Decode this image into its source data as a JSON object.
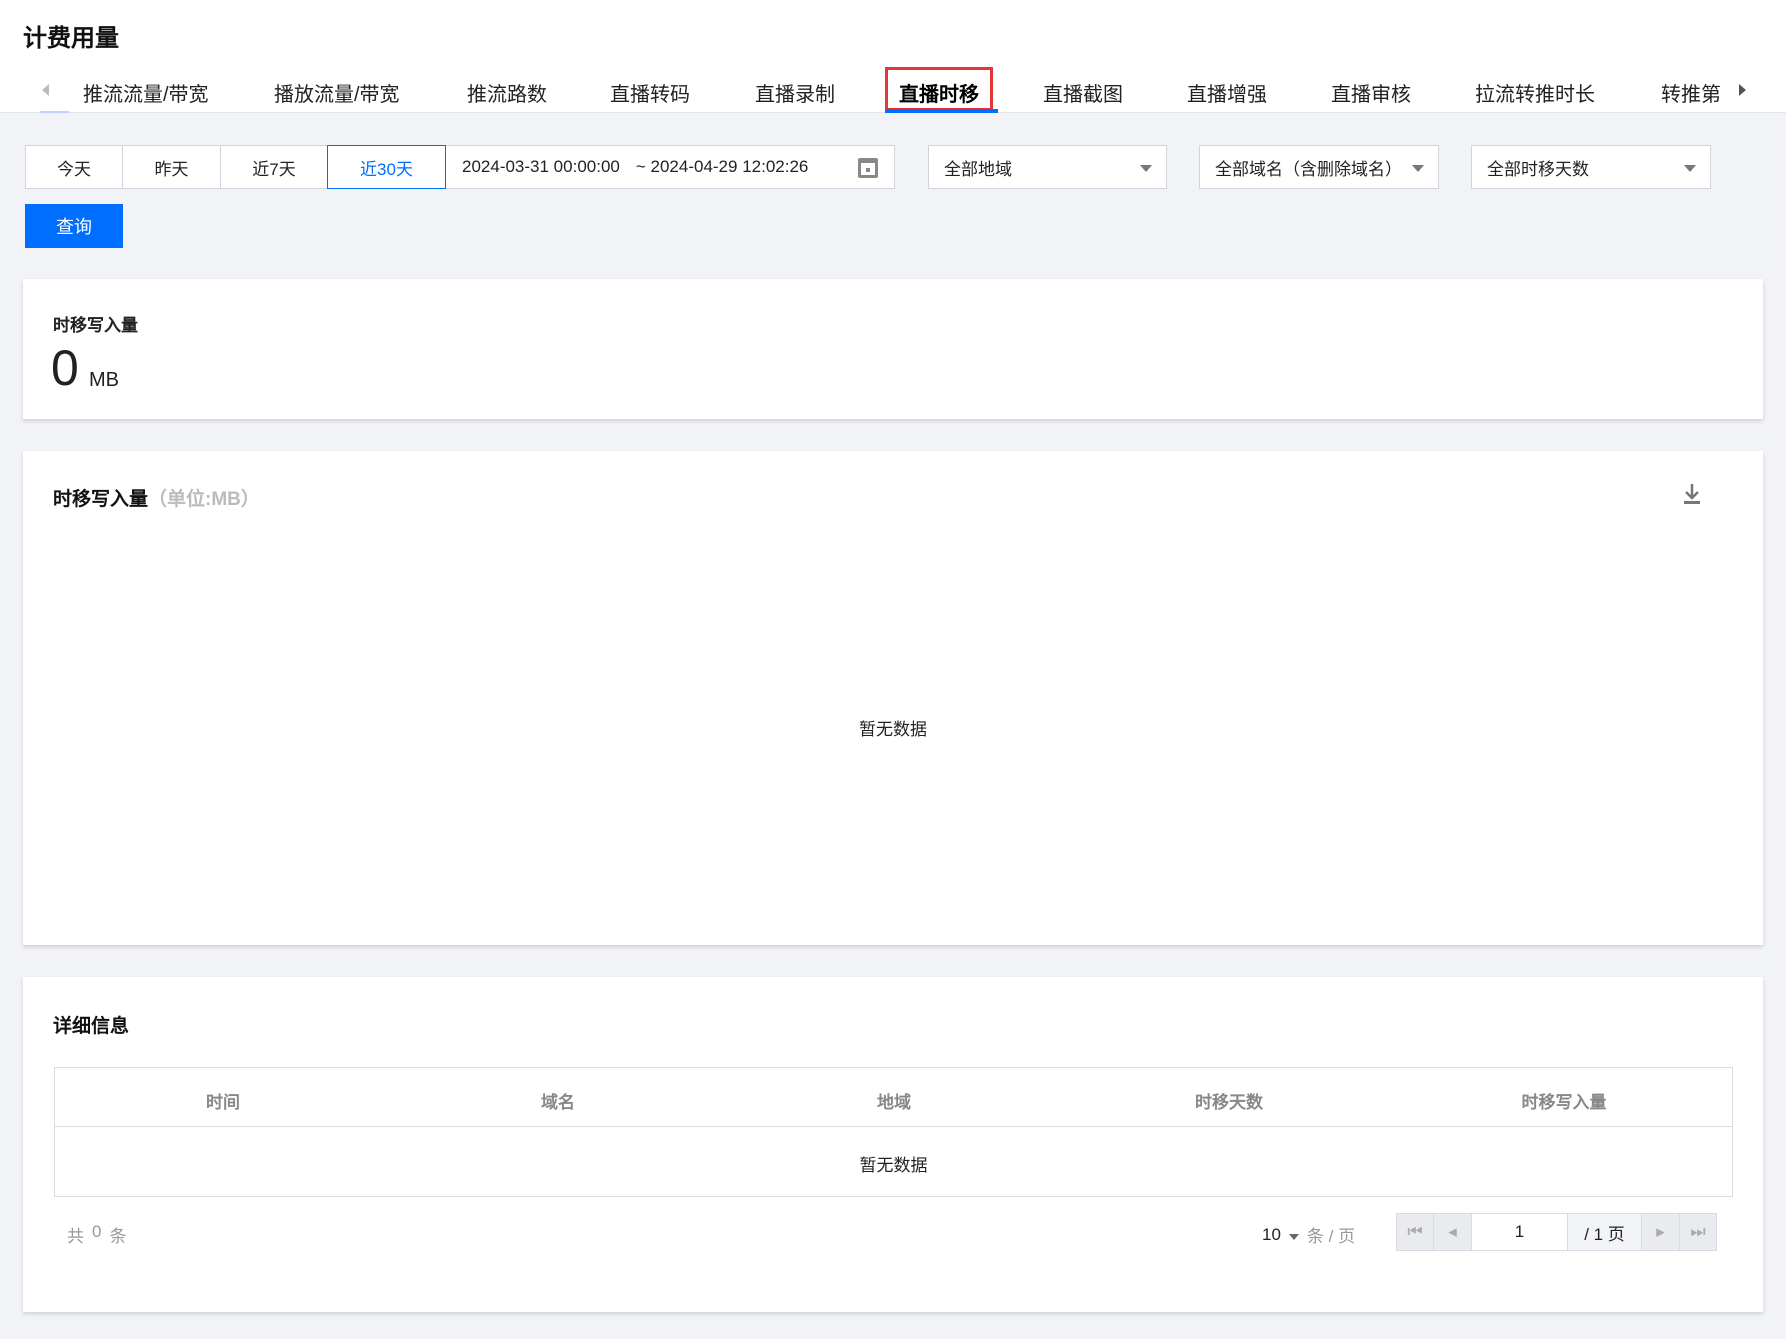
{
  "header": {
    "title": "计费用量"
  },
  "tabs": [
    "推流流量/带宽",
    "播放流量/带宽",
    "推流路数",
    "直播转码",
    "直播录制",
    "直播时移",
    "直播截图",
    "直播增强",
    "直播审核",
    "拉流转推时长",
    "转推第"
  ],
  "active_tab": "直播时移",
  "filters": {
    "quick": [
      "今天",
      "昨天",
      "近7天",
      "近30天"
    ],
    "active_quick": "近30天",
    "start": "2024-03-31 00:00:00",
    "end": "~ 2024-04-29 12:02:26",
    "region": "全部地域",
    "domain": "全部域名（含删除域名）",
    "days": "全部时移天数",
    "query": "查询"
  },
  "summary": {
    "label": "时移写入量",
    "value": "0",
    "unit": "MB"
  },
  "chart": {
    "title": "时移写入量",
    "unit": "（单位:MB）",
    "empty": "暂无数据"
  },
  "detail": {
    "title": "详细信息",
    "columns": [
      "时间",
      "域名",
      "地域",
      "时移天数",
      "时移写入量"
    ],
    "empty": "暂无数据"
  },
  "pagination": {
    "total_prefix": "共",
    "total": "0",
    "total_suffix": "条",
    "page_size": "10",
    "per_page": "条 / 页",
    "page": "1",
    "pages": "/ 1 页"
  },
  "colors": {
    "accent": "#006eff",
    "highlight": "#e5343a"
  }
}
